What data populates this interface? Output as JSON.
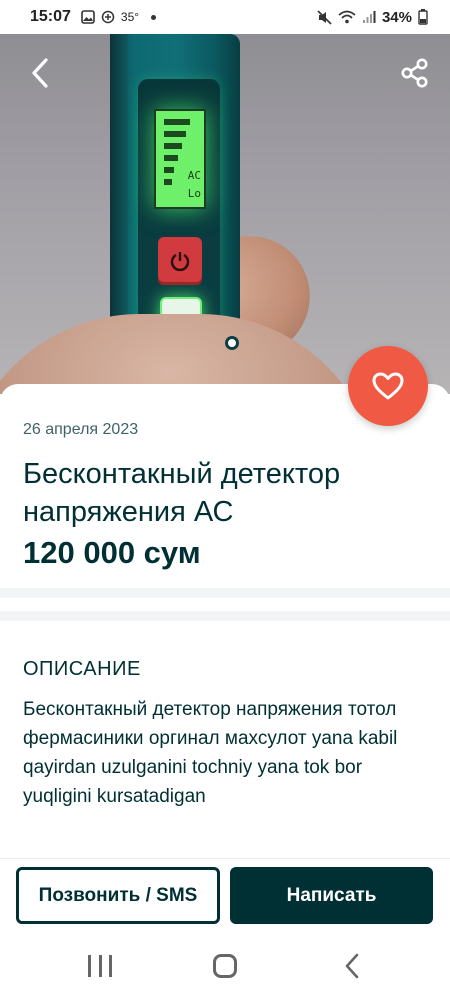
{
  "status_bar": {
    "time": "15:07",
    "temperature": "35°",
    "battery": "34%"
  },
  "photo": {
    "lcd_line1": "AC",
    "lcd_line2": "Lo"
  },
  "listing": {
    "date": "26 апреля 2023",
    "title": "Бесконтакный детектор напряжения АС",
    "price": "120 000 сум"
  },
  "description": {
    "heading": "ОПИСАНИЕ",
    "text": "Бесконтакный детектор напряжения тотол фермасиники оргинал махсулот yana kabil qayirdan uzulganini tochniy yana tok bor yuqligini kursatadigan"
  },
  "actions": {
    "call_label": "Позвонить / SMS",
    "write_label": "Написать"
  },
  "colors": {
    "primary": "#002f34",
    "favorite": "#f05a44",
    "divider": "#f2f4f5"
  },
  "icons": {
    "back": "chevron-left-icon",
    "share": "share-icon",
    "favorite": "heart-icon"
  }
}
